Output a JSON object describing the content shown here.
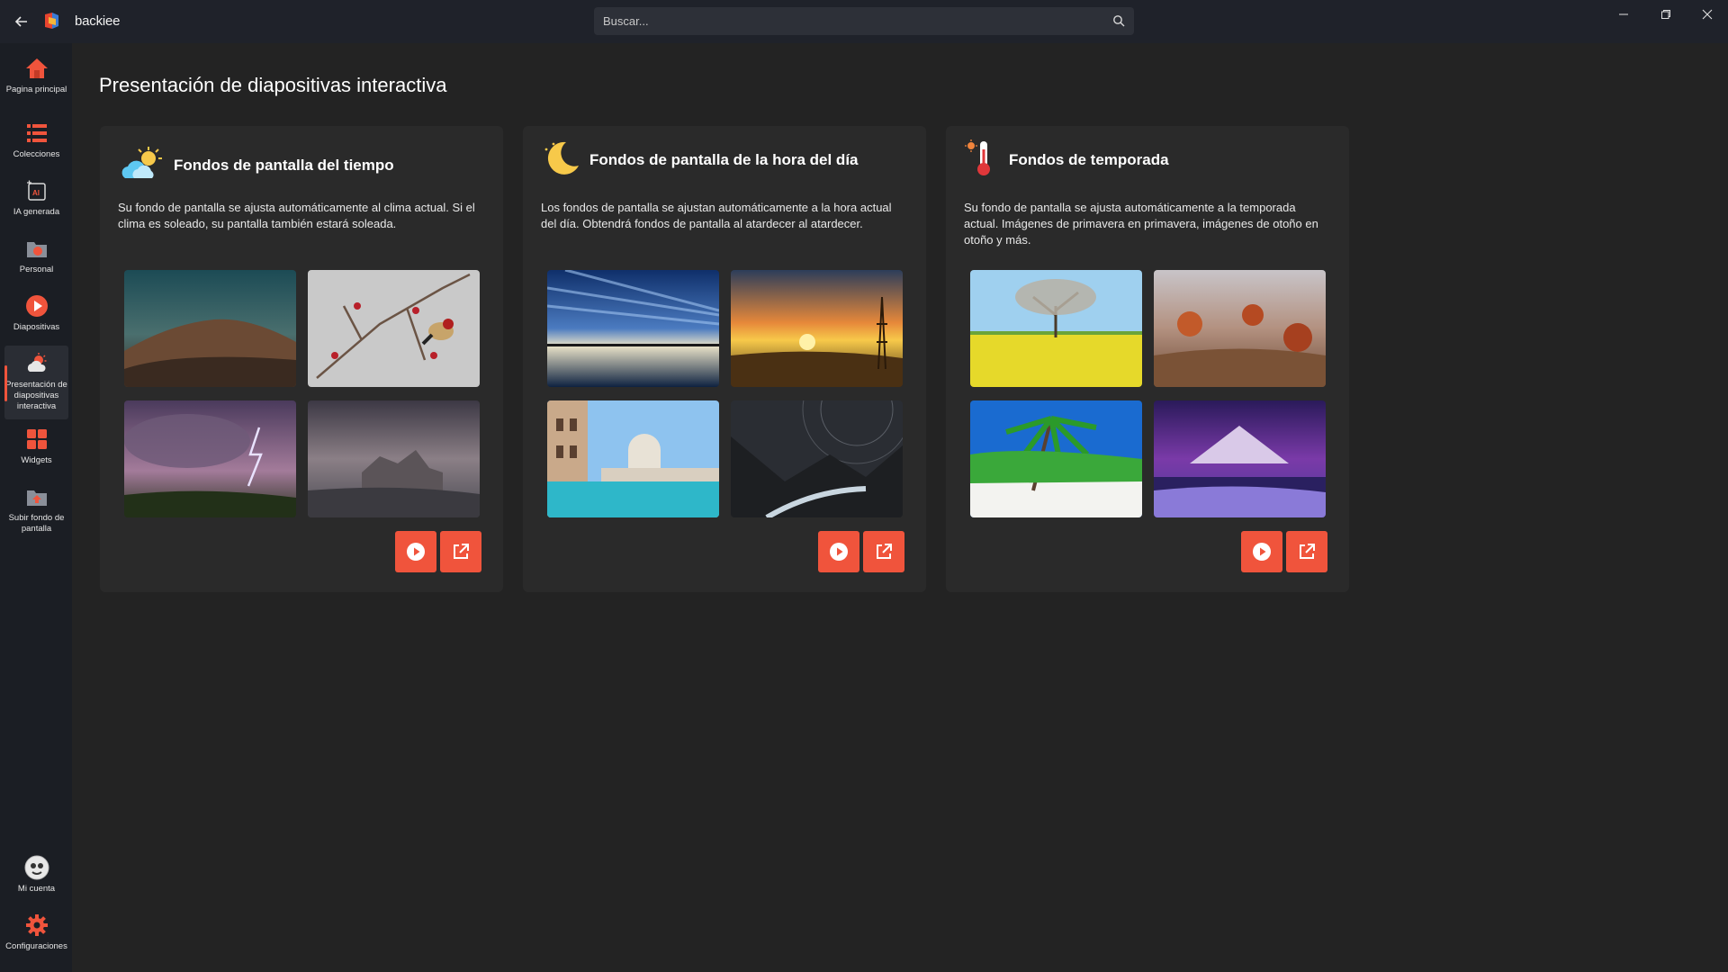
{
  "titlebar": {
    "app_name": "backiee",
    "search_placeholder": "Buscar...",
    "icons": [
      "back-arrow-icon",
      "backiee-logo",
      "search-icon",
      "minimize-icon",
      "restore-icon",
      "close-icon"
    ]
  },
  "sidebar": {
    "items": [
      {
        "label": "Pagina principal",
        "icon": "home-icon"
      },
      {
        "label": "Colecciones",
        "icon": "list-icon"
      },
      {
        "label": "IA generada",
        "icon": "ai-image-icon"
      },
      {
        "label": "Personal",
        "icon": "folder-icon"
      },
      {
        "label": "Diapositivas",
        "icon": "play-icon"
      },
      {
        "label": "Presentación de diapositivas interactiva",
        "icon": "weather-icon",
        "active": true
      },
      {
        "label": "Widgets",
        "icon": "widgets-icon"
      },
      {
        "label": "Subir fondo de pantalla",
        "icon": "upload-icon"
      }
    ],
    "bottom_items": [
      {
        "label": "Mi cuenta",
        "icon": "avatar"
      },
      {
        "label": "Configuraciones",
        "icon": "gear-icon"
      }
    ]
  },
  "main": {
    "title": "Presentación de diapositivas interactiva",
    "cards": [
      {
        "title": "Fondos de pantalla del tiempo",
        "icon": "cloud-sun-icon",
        "description": "Su fondo de pantalla se ajusta automáticamente al clima actual. Si el clima es soleado, su pantalla también estará soleada."
      },
      {
        "title": "Fondos de pantalla de la hora del día",
        "icon": "moon-icon",
        "description": "Los fondos de pantalla se ajustan automáticamente a la hora actual del día. Obtendrá fondos de pantalla al atardecer al atardecer."
      },
      {
        "title": "Fondos de temporada",
        "icon": "thermometer-icon",
        "description": "Su fondo de pantalla se ajusta automáticamente a la temporada actual. Imágenes de primavera en primavera, imágenes de otoño en otoño y más."
      }
    ]
  },
  "colors": {
    "accent": "#f0543c",
    "background": "#232323",
    "card": "#2a2a2a",
    "sidebar": "#1b1e24",
    "titlebar": "#1f222a"
  }
}
